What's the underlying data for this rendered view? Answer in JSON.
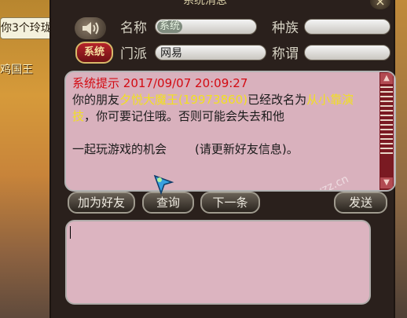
{
  "window": {
    "title": "系统消息",
    "close_label": "×"
  },
  "scene": {
    "bubble_text": "你3个玲珑。",
    "npc_name": "鸡国王"
  },
  "sender": {
    "system_button": "系统",
    "name_label": "名称",
    "name_value": "系统",
    "race_label": "种族",
    "race_value": "",
    "school_label": "门派",
    "school_value": "网易",
    "title_label": "称谓",
    "title_value": ""
  },
  "message": {
    "header": "系统提示",
    "timestamp": "2017/09/07 20:09:27",
    "part1": "你的朋友",
    "friend": "夕悦大魔王(19973860)",
    "part2": "已经改名为",
    "newname": "从小靠演技",
    "part3": "，你可要记住哦。否则可能会失去和他",
    "part4": "一起玩游戏的机会",
    "part5": "(请更新好友信息)。"
  },
  "watermark": "叶子猪梦幻西游 aq.yzz.cn",
  "buttons": {
    "add_friend": "加为好友",
    "query": "查询",
    "next": "下一条",
    "send": "发送"
  },
  "input": {
    "value": ""
  },
  "icons": [
    "speaker-icon",
    "scroll-up-icon",
    "scroll-down-icon",
    "mouse-cursor-icon",
    "emote-icon"
  ]
}
